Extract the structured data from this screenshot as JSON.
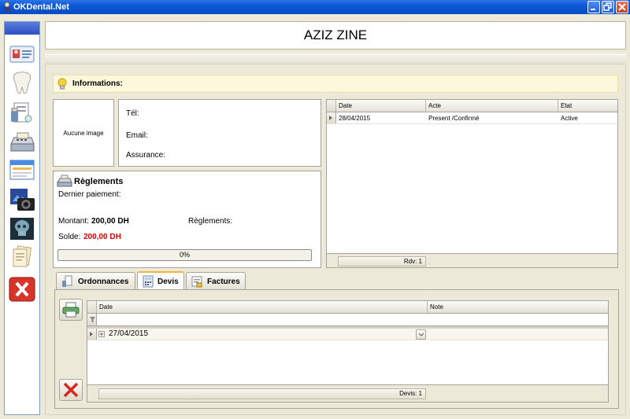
{
  "window": {
    "title": "OKDental.Net"
  },
  "sidebar": {
    "items": [
      {
        "icon": "patient-card-icon"
      },
      {
        "icon": "tooth-icon"
      },
      {
        "icon": "prescription-icon"
      },
      {
        "icon": "cash-register-icon"
      },
      {
        "icon": "window-icon"
      },
      {
        "icon": "camera-icon"
      },
      {
        "icon": "xray-icon"
      },
      {
        "icon": "documents-icon"
      },
      {
        "icon": "close-icon"
      }
    ]
  },
  "patient": {
    "name": "AZIZ ZINE"
  },
  "info": {
    "title": "Informations:"
  },
  "photo": {
    "placeholder": "Aucune image"
  },
  "contact": {
    "tel_label": "Tél:",
    "email_label": "Email:",
    "insurance_label": "Assurance:"
  },
  "payments": {
    "title": "Règlements",
    "last_payment_label": "Dernier paiement:",
    "amount_label": "Montant:",
    "amount_value": "200,00 DH",
    "payments_label": "Règlements:",
    "balance_label": "Solde:",
    "balance_value": "200,00 DH",
    "progress_text": "0%",
    "progress": 0,
    "balance_color": "#e00000"
  },
  "appointments": {
    "columns": [
      "Date",
      "Acte",
      "Etat"
    ],
    "rows": [
      {
        "date": "28/04/2015",
        "acte": "Present /Confirmé",
        "etat": "Active"
      }
    ],
    "footer": "Rdv: 1"
  },
  "tabs": [
    {
      "label": "Ordonnances",
      "icon": "prescription-icon"
    },
    {
      "label": "Devis",
      "icon": "calculator-icon"
    },
    {
      "label": "Factures",
      "icon": "invoice-icon"
    }
  ],
  "active_tab": "Devis",
  "quotes": {
    "columns": [
      "Date",
      "Note"
    ],
    "rows": [
      {
        "date": "27/04/2015",
        "note": ""
      }
    ],
    "footer": "Devis: 1"
  },
  "colors": {
    "titlebar": "#0a57d8",
    "accent_tab": "#f3b33d",
    "info_bg": "#fbf8dc"
  }
}
